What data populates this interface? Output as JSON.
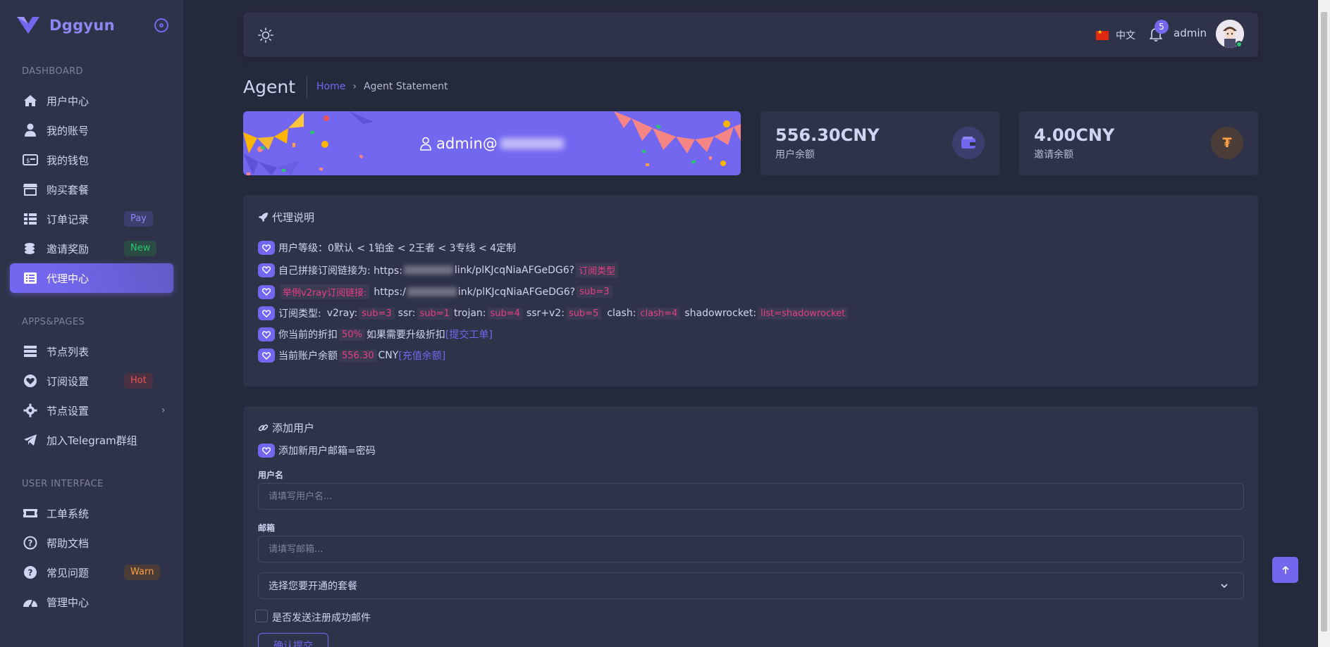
{
  "brand": {
    "name": "Dggyun"
  },
  "sidebar": {
    "sections": [
      {
        "title": "DASHBOARD"
      },
      {
        "title": "APPS&PAGES"
      },
      {
        "title": "USER INTERFACE"
      }
    ],
    "items": [
      {
        "label": "用户中心",
        "icon": "home-icon"
      },
      {
        "label": "我的账号",
        "icon": "user-icon"
      },
      {
        "label": "我的钱包",
        "icon": "money-bill-icon"
      },
      {
        "label": "购买套餐",
        "icon": "store-icon"
      },
      {
        "label": "订单记录",
        "icon": "list-table-icon",
        "badge": "Pay"
      },
      {
        "label": "邀请奖励",
        "icon": "coins-icon",
        "badge": "New"
      },
      {
        "label": "代理中心",
        "icon": "list-alt-icon",
        "active": true
      },
      {
        "label": "节点列表",
        "icon": "server-list-icon"
      },
      {
        "label": "订阅设置",
        "icon": "heart-circle-icon",
        "badge": "Hot"
      },
      {
        "label": "节点设置",
        "icon": "gear-icon",
        "has_submenu": true
      },
      {
        "label": "加入Telegram群组",
        "icon": "telegram-icon"
      },
      {
        "label": "工单系统",
        "icon": "ticket-icon"
      },
      {
        "label": "帮助文档",
        "icon": "question-circle-icon"
      },
      {
        "label": "常见问题",
        "icon": "question-icon",
        "badge": "Warn"
      },
      {
        "label": "管理中心",
        "icon": "dashboard-gauge-icon"
      }
    ]
  },
  "topbar": {
    "language": "中文",
    "notifications": "5",
    "username": "admin"
  },
  "header": {
    "title": "Agent",
    "breadcrumb_home": "Home",
    "breadcrumb_current": "Agent Statement"
  },
  "hero": {
    "user_prefix": "admin@"
  },
  "stats": [
    {
      "value": "556.30CNY",
      "label": "用户余额",
      "icon": "wallet-icon",
      "color": "#7367f0"
    },
    {
      "value": "4.00CNY",
      "label": "邀请余额",
      "icon": "tugrik-coin-icon",
      "color": "#ff9f43"
    }
  ],
  "agent_info": {
    "title": "代理说明",
    "level_line": "用户等级：0默认 < 1铂金 < 2王者 < 3专线 < 4定制",
    "sub_link_prefix": "自己拼接订阅链接为: https:",
    "sub_link_suffix": "link/plKJcqNiaAFGeDG6?",
    "sub_link_tag": "订阅类型",
    "example_tag": "举例v2ray订阅链接:",
    "example_prefix": "https:/",
    "example_suffix": "ink/plKJcqNiaAFGeDG6?",
    "example_code": "sub=3",
    "types_label": "订阅类型:",
    "types": [
      {
        "name": "v2ray:",
        "code": "sub=3"
      },
      {
        "name": "ssr:",
        "code": "sub=1"
      },
      {
        "name": "trojan:",
        "code": "sub=4"
      },
      {
        "name": "ssr+v2:",
        "code": "sub=5"
      },
      {
        "name": "clash:",
        "code": "clash=4"
      },
      {
        "name": "shadowrocket:",
        "code": "list=shadowrocket"
      }
    ],
    "discount_prefix": "你当前的折扣",
    "discount_value": "50%",
    "discount_suffix": "如果需要升级折扣",
    "discount_link": "[提交工单]",
    "balance_prefix": "当前账户余额",
    "balance_value": "556.30",
    "balance_unit": "CNY",
    "balance_link": "[充值余额]"
  },
  "add_user": {
    "title": "添加用户",
    "hint": "添加新用户邮箱=密码",
    "username_label": "用户名",
    "username_placeholder": "请填写用户名...",
    "email_label": "邮箱",
    "email_placeholder": "请填写邮箱...",
    "plan_select": "选择您要开通的套餐",
    "send_mail_label": "是否发送注册成功邮件",
    "submit_label": "确认提交"
  }
}
